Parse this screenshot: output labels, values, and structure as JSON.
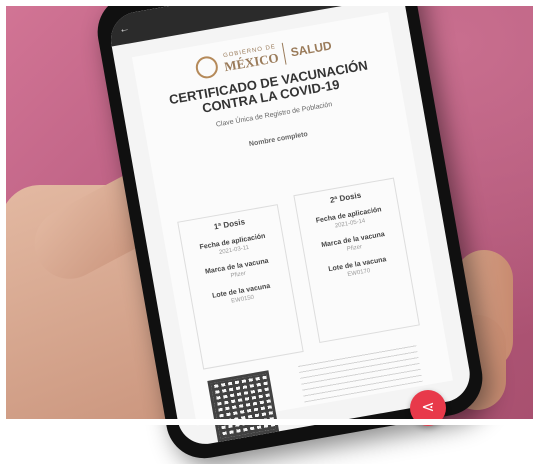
{
  "photo": {
    "background_color": "#c16684",
    "accent_color": "#e8394a"
  },
  "certificate": {
    "gob_label": "GOBIERNO DE",
    "country": "MÉXICO",
    "ministry": "SALUD",
    "title_line1": "CERTIFICADO DE VACUNACIÓN",
    "title_line2": "CONTRA LA COVID-19",
    "curp_label": "Clave Única de Registro de Población",
    "name_label": "Nombre completo",
    "dose1": {
      "title": "1ª Dosis",
      "date_label": "Fecha de aplicación",
      "date_value": "2021-03-11",
      "brand_label": "Marca de la vacuna",
      "brand_value": "Pfizer",
      "lot_label": "Lote de la vacuna",
      "lot_value": "EW0150"
    },
    "dose2": {
      "title": "2ª Dosis",
      "date_label": "Fecha de aplicación",
      "date_value": "2021-05-14",
      "brand_label": "Marca de la vacuna",
      "brand_value": "Pfizer",
      "lot_label": "Lote de la vacuna",
      "lot_value": "EW0170"
    }
  },
  "share_button": {
    "icon": "share-icon",
    "glyph": "⋖"
  }
}
